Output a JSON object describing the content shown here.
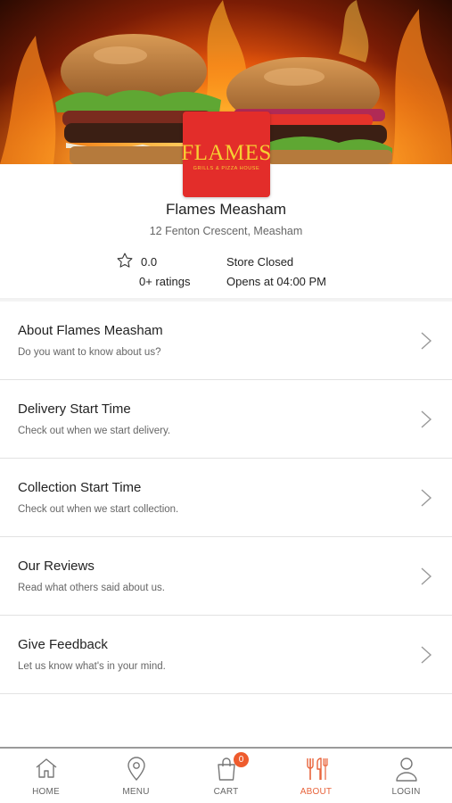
{
  "store": {
    "logo_text": "FLAMES",
    "logo_tagline": "GRILLS & PIZZA HOUSE",
    "name": "Flames Measham",
    "address": "12 Fenton Crescent, Measham",
    "rating": "0.0",
    "ratings_count": "0+ ratings",
    "status": "Store Closed",
    "opens": "Opens at 04:00 PM"
  },
  "menu_items": [
    {
      "title": "About Flames Measham",
      "subtitle": "Do you want to know about us?"
    },
    {
      "title": "Delivery Start Time",
      "subtitle": "Check out when we start delivery."
    },
    {
      "title": "Collection Start Time",
      "subtitle": "Check out when we start collection."
    },
    {
      "title": "Our Reviews",
      "subtitle": "Read what others said about us."
    },
    {
      "title": "Give Feedback",
      "subtitle": "Let us know what's in your mind."
    }
  ],
  "bottom_nav": {
    "items": [
      {
        "label": "HOME",
        "icon": "home-icon"
      },
      {
        "label": "MENU",
        "icon": "location-pin-icon"
      },
      {
        "label": "CART",
        "icon": "shopping-bag-icon",
        "badge": "0"
      },
      {
        "label": "ABOUT",
        "icon": "fork-knife-icon",
        "active": true
      },
      {
        "label": "LOGIN",
        "icon": "user-icon"
      }
    ]
  },
  "colors": {
    "accent": "#e8643c",
    "logo_background": "#e32d2a",
    "logo_text": "#f6d033",
    "badge": "#ee5b2d"
  }
}
